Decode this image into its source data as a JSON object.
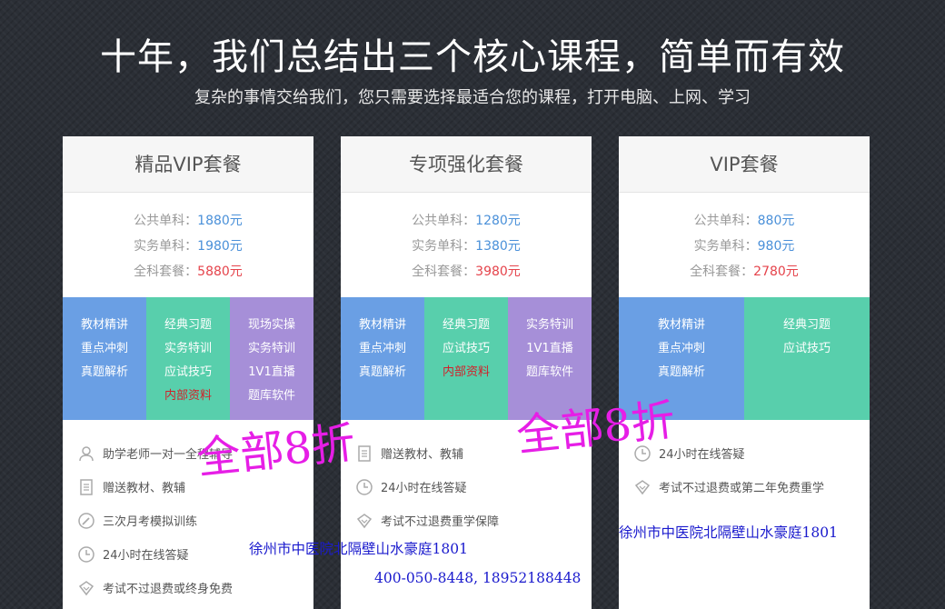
{
  "header": {
    "title": "十年，我们总结出三个核心课程，简单而有效",
    "subtitle": "复杂的事情交给我们，您只需要选择最适合您的课程，打开电脑、上网、学习"
  },
  "cards": [
    {
      "name": "精品VIP套餐",
      "prices": [
        {
          "label": "公共单科：",
          "value": "1880元"
        },
        {
          "label": "实务单科：",
          "value": "1980元"
        },
        {
          "label": "全科套餐：",
          "value": "5880元"
        }
      ],
      "features": [
        {
          "items": [
            "教材精讲",
            "重点冲刺",
            "真题解析"
          ]
        },
        {
          "items": [
            "经典习题",
            "实务特训",
            "应试技巧",
            "内部资料"
          ]
        },
        {
          "items": [
            "现场实操",
            "实务特训",
            "1V1直播",
            "题库软件"
          ]
        }
      ],
      "services": [
        "助学老师一对一全程辅导",
        "赠送教材、教辅",
        "三次月考模拟训练",
        "24小时在线答疑",
        "考试不过退费或终身免费"
      ]
    },
    {
      "name": "专项强化套餐",
      "prices": [
        {
          "label": "公共单科：",
          "value": "1280元"
        },
        {
          "label": "实务单科：",
          "value": "1380元"
        },
        {
          "label": "全科套餐：",
          "value": "3980元"
        }
      ],
      "features": [
        {
          "items": [
            "教材精讲",
            "重点冲刺",
            "真题解析"
          ]
        },
        {
          "items": [
            "经典习题",
            "应试技巧",
            "内部资料"
          ]
        },
        {
          "items": [
            "实务特训",
            "1V1直播",
            "题库软件"
          ]
        }
      ],
      "services": [
        "赠送教材、教辅",
        "24小时在线答疑",
        "考试不过退费重学保障"
      ]
    },
    {
      "name": "VIP套餐",
      "prices": [
        {
          "label": "公共单科：",
          "value": "880元"
        },
        {
          "label": "实务单科：",
          "value": "980元"
        },
        {
          "label": "全科套餐：",
          "value": "2780元"
        }
      ],
      "features": [
        {
          "items": [
            "教材精讲",
            "重点冲刺",
            "真题解析"
          ]
        },
        {
          "items": [
            "经典习题",
            "应试技巧"
          ]
        }
      ],
      "services": [
        "24小时在线答疑",
        "考试不过退费或第二年免费重学"
      ]
    }
  ],
  "overlay": {
    "stamp_1": "全部8折",
    "stamp_2": "全部8折",
    "address_1": "徐州市中医院北隔壁山水豪庭1801",
    "phone": "400-050-8448, 18952188448",
    "address_2": "徐州市中医院北隔壁山水豪庭1801"
  },
  "colors": {
    "feature_blue": "#6a9fe4",
    "feature_green": "#58cfac",
    "feature_purple": "#a68fd8",
    "price_blue": "#4a90d9",
    "price_red": "#e5434b",
    "highlight_red": "#d2202a",
    "stamp_magenta": "#e61ee6",
    "address_blue": "#1a1acd"
  }
}
